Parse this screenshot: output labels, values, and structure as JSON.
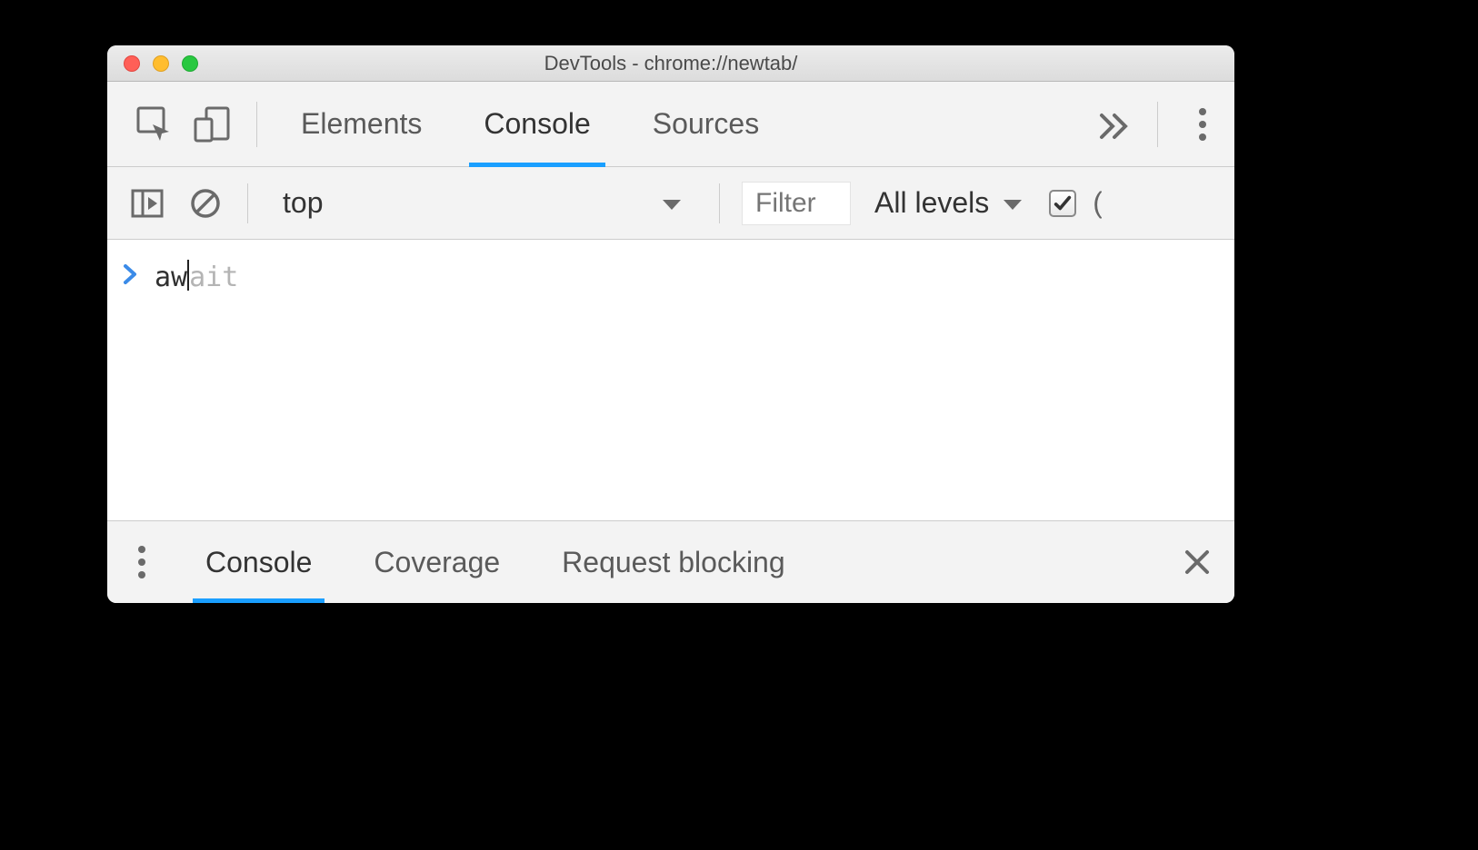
{
  "window": {
    "title": "DevTools - chrome://newtab/"
  },
  "mainTabs": {
    "items": [
      {
        "label": "Elements",
        "active": false
      },
      {
        "label": "Console",
        "active": true
      },
      {
        "label": "Sources",
        "active": false
      }
    ]
  },
  "consoleToolbar": {
    "context": "top",
    "filterPlaceholder": "Filter",
    "levelsLabel": "All levels"
  },
  "consoleInput": {
    "typed": "aw",
    "suggestion": "ait"
  },
  "drawer": {
    "items": [
      {
        "label": "Console",
        "active": true
      },
      {
        "label": "Coverage",
        "active": false
      },
      {
        "label": "Request blocking",
        "active": false
      }
    ]
  }
}
